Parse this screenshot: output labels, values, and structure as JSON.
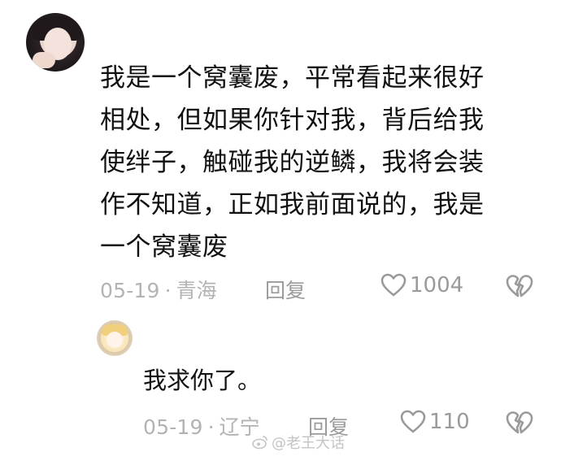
{
  "comment": {
    "lines": [
      "我是一个窝囊废，平常看起来很好",
      "相处，但如果你针对我，背后给我",
      "使绊子，触碰我的逆鳞，我将会装",
      "作不知道，正如我前面说的，我是",
      "一个窝囊废"
    ],
    "date": "05-19",
    "separator": "·",
    "location": "青海",
    "reply_label": "回复",
    "likes": "1004",
    "avatar_icon": "user-avatar-icon"
  },
  "reply": {
    "text": "我求你了。",
    "date": "05-19",
    "separator": "·",
    "location": "辽宁",
    "reply_label": "回复",
    "likes": "110",
    "avatar_icon": "user-avatar-icon"
  },
  "watermark": {
    "text": "@老王大话"
  },
  "colors": {
    "text": "#111111",
    "meta": "#b3b3b3",
    "icon": "#9a9a9a"
  }
}
